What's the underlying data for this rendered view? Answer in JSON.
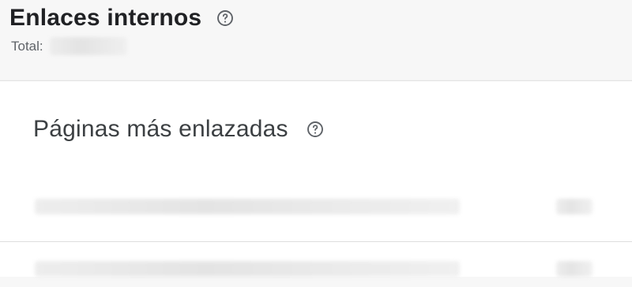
{
  "header": {
    "title": "Enlaces internos",
    "help_icon": "help-circle-icon",
    "total_label": "Total:",
    "total_value": ""
  },
  "section": {
    "title": "Páginas más enlazadas",
    "help_icon": "help-circle-icon"
  },
  "rows": [
    {
      "url": "",
      "count": ""
    },
    {
      "url": "",
      "count": ""
    }
  ],
  "colors": {
    "page_background": "#f7f7f7",
    "card_background": "#ffffff",
    "primary_text": "#202124",
    "secondary_text": "#5f6368",
    "divider": "#dedede"
  }
}
